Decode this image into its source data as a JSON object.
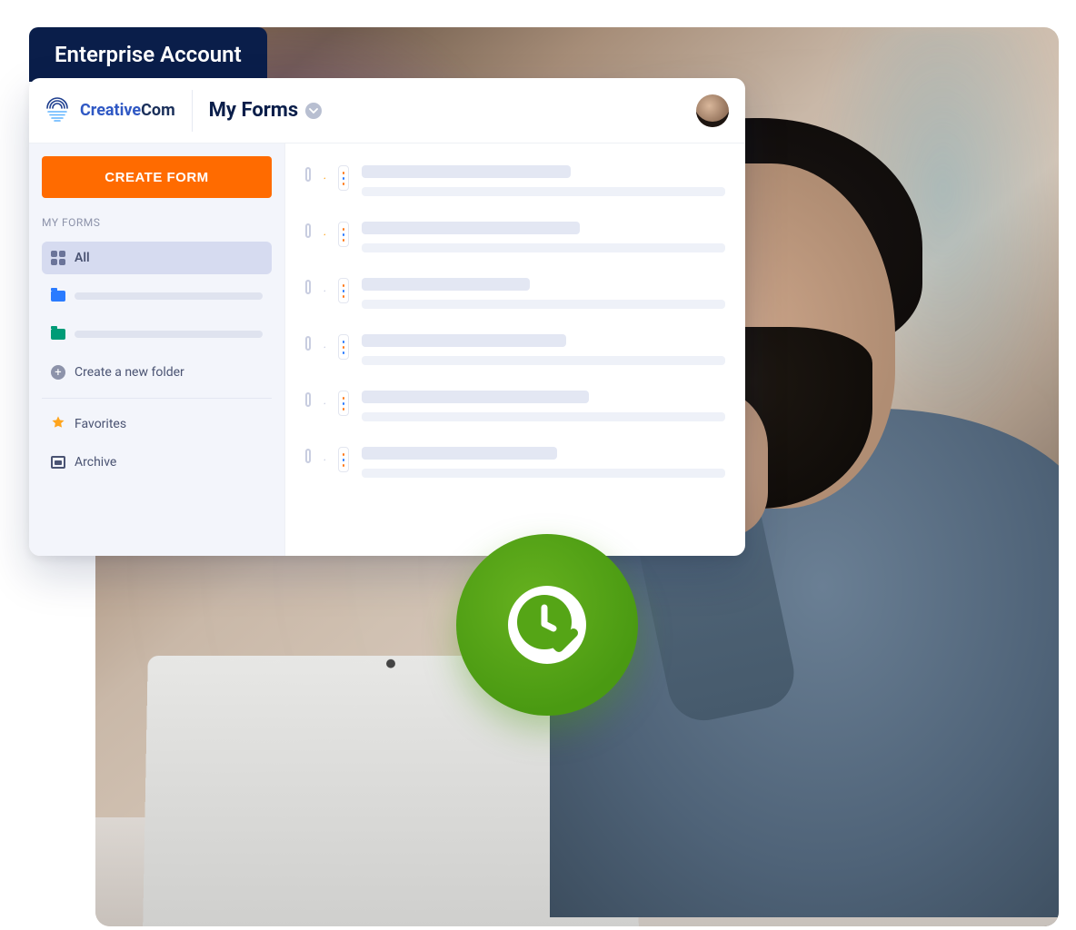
{
  "tab_label": "Enterprise Account",
  "brand": {
    "part1": "Creative",
    "part2": "Com"
  },
  "page_title": "My Forms",
  "sidebar": {
    "create_label": "CREATE FORM",
    "section_label": "MY FORMS",
    "all_label": "All",
    "create_folder_label": "Create a new folder",
    "favorites_label": "Favorites",
    "archive_label": "Archive"
  },
  "forms": [
    {
      "starred": true,
      "variant": "orange",
      "title_w": 230,
      "sub_w": 400
    },
    {
      "starred": true,
      "variant": "orange",
      "title_w": 240,
      "sub_w": 400
    },
    {
      "starred": false,
      "variant": "orange",
      "title_w": 185,
      "sub_w": 400
    },
    {
      "starred": false,
      "variant": "blue",
      "title_w": 225,
      "sub_w": 400
    },
    {
      "starred": false,
      "variant": "orange",
      "title_w": 250,
      "sub_w": 400
    },
    {
      "starred": false,
      "variant": "orange",
      "title_w": 215,
      "sub_w": 400
    }
  ],
  "colors": {
    "accent_orange": "#ff6b00",
    "navy": "#0a1e4a",
    "badge_green": "#55a516"
  }
}
